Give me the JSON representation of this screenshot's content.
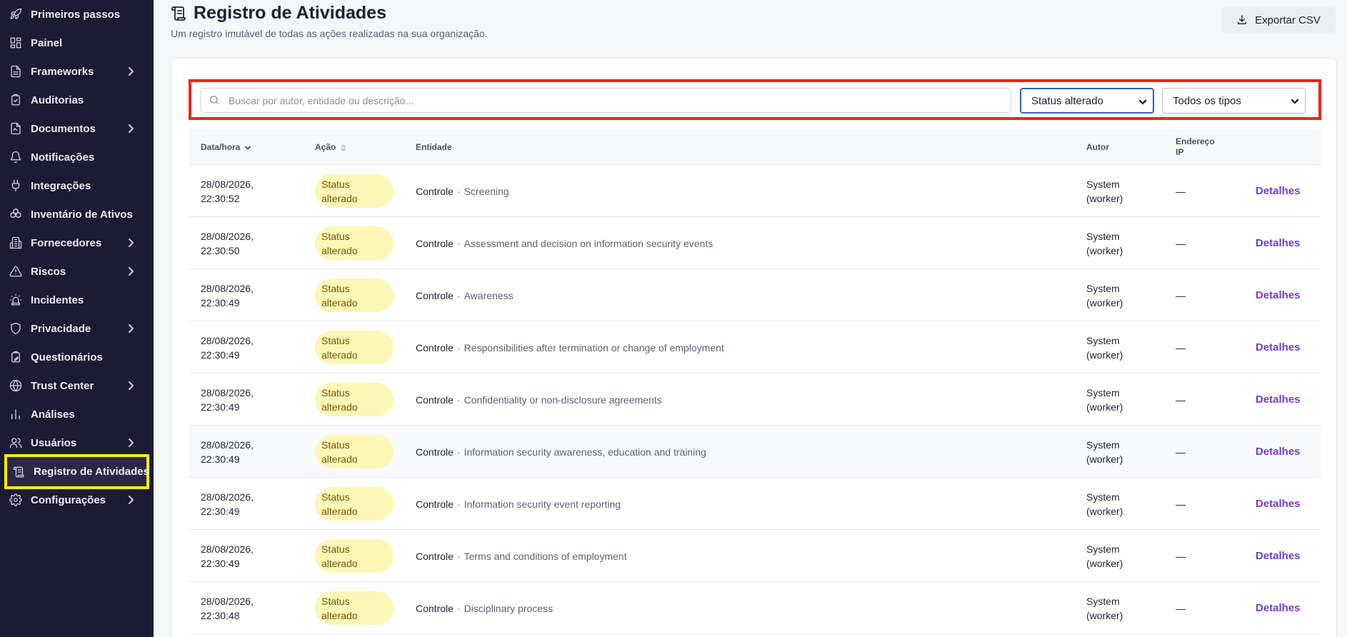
{
  "sidebar": {
    "items": [
      {
        "label": "Primeiros passos",
        "icon": "rocket-icon",
        "chevron": false
      },
      {
        "label": "Painel",
        "icon": "dashboard-icon",
        "chevron": false
      },
      {
        "label": "Frameworks",
        "icon": "document-icon",
        "chevron": true
      },
      {
        "label": "Auditorias",
        "icon": "clipboard-check-icon",
        "chevron": false
      },
      {
        "label": "Documentos",
        "icon": "file-text-icon",
        "chevron": true
      },
      {
        "label": "Notificações",
        "icon": "bell-icon",
        "chevron": false
      },
      {
        "label": "Integrações",
        "icon": "plug-icon",
        "chevron": false
      },
      {
        "label": "Inventário de Ativos",
        "icon": "boxes-icon",
        "chevron": false
      },
      {
        "label": "Fornecedores",
        "icon": "building-icon",
        "chevron": true
      },
      {
        "label": "Riscos",
        "icon": "warning-triangle-icon",
        "chevron": true
      },
      {
        "label": "Incidentes",
        "icon": "siren-icon",
        "chevron": false
      },
      {
        "label": "Privacidade",
        "icon": "shield-icon",
        "chevron": true
      },
      {
        "label": "Questionários",
        "icon": "clipboard-pen-icon",
        "chevron": false
      },
      {
        "label": "Trust Center",
        "icon": "globe-icon",
        "chevron": true
      },
      {
        "label": "Análises",
        "icon": "bar-chart-icon",
        "chevron": false
      },
      {
        "label": "Usuários",
        "icon": "users-icon",
        "chevron": true
      },
      {
        "label": "Registro de Atividades",
        "icon": "scroll-icon",
        "chevron": false,
        "active": true
      },
      {
        "label": "Configurações",
        "icon": "gear-icon",
        "chevron": true
      }
    ]
  },
  "header": {
    "title": "Registro de Atividades",
    "subtitle": "Um registro imutável de todas as ações realizadas na sua organização.",
    "export_label": "Exportar CSV"
  },
  "filters": {
    "search_placeholder": "Buscar por autor, entidade ou descrição...",
    "status_selected": "Status alterado",
    "type_selected": "Todos os tipos"
  },
  "table": {
    "columns": {
      "datetime": "Data/hora",
      "action": "Ação",
      "entity": "Entidade",
      "author": "Autor",
      "ip_line1": "Endereço",
      "ip_line2": "IP"
    },
    "rows": [
      {
        "date": "28/08/2026,",
        "time": "22:30:52",
        "action_line1": "Status",
        "action_line2": "alterado",
        "entity_type": "Controle",
        "sep": "·",
        "entity_name": "Screening",
        "author_line1": "System",
        "author_line2": "(worker)",
        "ip": "—",
        "details": "Detalhes"
      },
      {
        "date": "28/08/2026,",
        "time": "22:30:50",
        "action_line1": "Status",
        "action_line2": "alterado",
        "entity_type": "Controle",
        "sep": "·",
        "entity_name": "Assessment and decision on information security events",
        "author_line1": "System",
        "author_line2": "(worker)",
        "ip": "—",
        "details": "Detalhes"
      },
      {
        "date": "28/08/2026,",
        "time": "22:30:49",
        "action_line1": "Status",
        "action_line2": "alterado",
        "entity_type": "Controle",
        "sep": "·",
        "entity_name": "Awareness",
        "author_line1": "System",
        "author_line2": "(worker)",
        "ip": "—",
        "details": "Detalhes"
      },
      {
        "date": "28/08/2026,",
        "time": "22:30:49",
        "action_line1": "Status",
        "action_line2": "alterado",
        "entity_type": "Controle",
        "sep": "·",
        "entity_name": "Responsibilities after termination or change of employment",
        "author_line1": "System",
        "author_line2": "(worker)",
        "ip": "—",
        "details": "Detalhes"
      },
      {
        "date": "28/08/2026,",
        "time": "22:30:49",
        "action_line1": "Status",
        "action_line2": "alterado",
        "entity_type": "Controle",
        "sep": "·",
        "entity_name": "Confidentiality or non-disclosure agreements",
        "author_line1": "System",
        "author_line2": "(worker)",
        "ip": "—",
        "details": "Detalhes"
      },
      {
        "date": "28/08/2026,",
        "time": "22:30:49",
        "action_line1": "Status",
        "action_line2": "alterado",
        "entity_type": "Controle",
        "sep": "·",
        "entity_name": "Information security awareness, education and training",
        "author_line1": "System",
        "author_line2": "(worker)",
        "ip": "—",
        "details": "Detalhes"
      },
      {
        "date": "28/08/2026,",
        "time": "22:30:49",
        "action_line1": "Status",
        "action_line2": "alterado",
        "entity_type": "Controle",
        "sep": "·",
        "entity_name": "Information security event reporting",
        "author_line1": "System",
        "author_line2": "(worker)",
        "ip": "—",
        "details": "Detalhes"
      },
      {
        "date": "28/08/2026,",
        "time": "22:30:49",
        "action_line1": "Status",
        "action_line2": "alterado",
        "entity_type": "Controle",
        "sep": "·",
        "entity_name": "Terms and conditions of employment",
        "author_line1": "System",
        "author_line2": "(worker)",
        "ip": "—",
        "details": "Detalhes"
      },
      {
        "date": "28/08/2026,",
        "time": "22:30:48",
        "action_line1": "Status",
        "action_line2": "alterado",
        "entity_type": "Controle",
        "sep": "·",
        "entity_name": "Disciplinary process",
        "author_line1": "System",
        "author_line2": "(worker)",
        "ip": "—",
        "details": "Detalhes"
      }
    ]
  },
  "colors": {
    "sidebar_bg": "#1d1a33",
    "active_outline": "#f4ef0a",
    "filter_outline": "#e8251a",
    "badge_bg": "#fcf7b6",
    "link": "#7140c9"
  }
}
